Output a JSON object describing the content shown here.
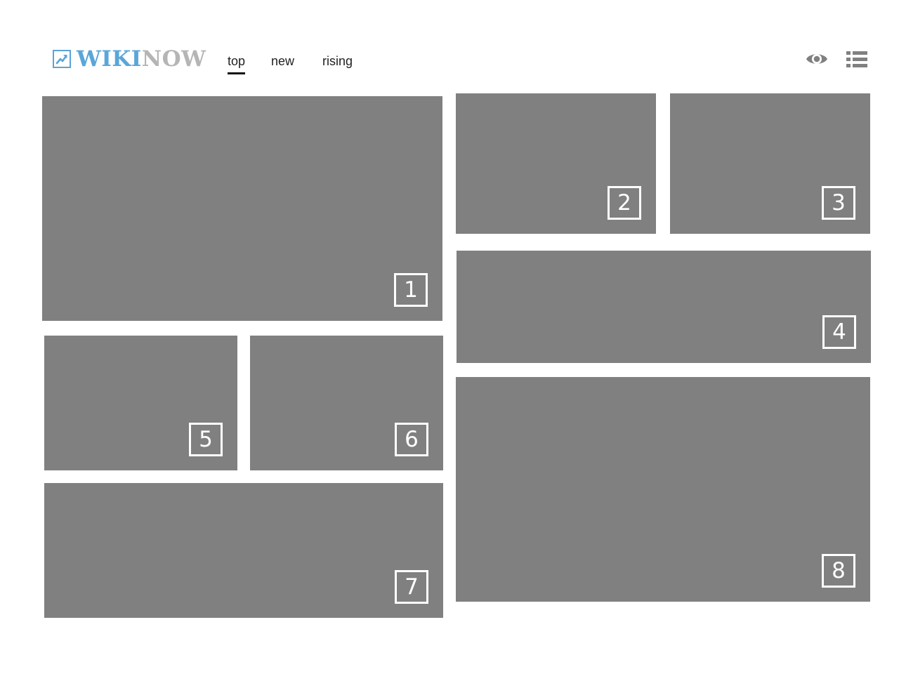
{
  "header": {
    "logo": {
      "icon": "trending-up-icon",
      "word_part1": "WIKI",
      "word_part2": "NOW",
      "colors": {
        "primary": "#5aa6d9",
        "secondary": "#b5b5b5"
      }
    },
    "tabs": [
      {
        "label": "top",
        "active": true
      },
      {
        "label": "new",
        "active": false
      },
      {
        "label": "rising",
        "active": false
      }
    ],
    "actions": [
      {
        "icon": "eye-icon"
      },
      {
        "icon": "list-icon"
      }
    ]
  },
  "tiles": [
    {
      "number": "1"
    },
    {
      "number": "2"
    },
    {
      "number": "3"
    },
    {
      "number": "4"
    },
    {
      "number": "5"
    },
    {
      "number": "6"
    },
    {
      "number": "7"
    },
    {
      "number": "8"
    }
  ],
  "colors": {
    "tile_fill": "#7f807f",
    "background": "#ffffff",
    "icon_gray": "#808080"
  }
}
